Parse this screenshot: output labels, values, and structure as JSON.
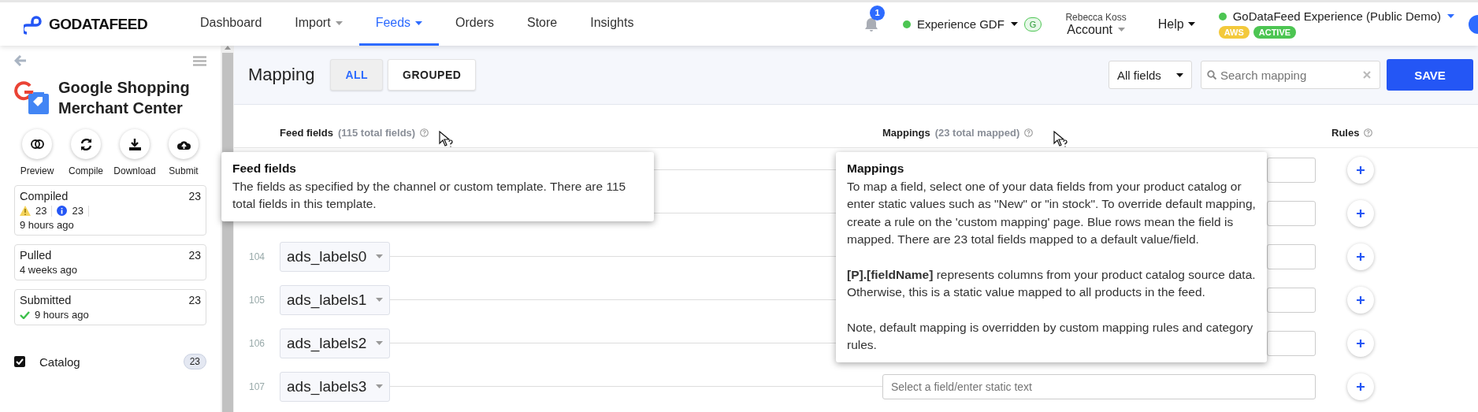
{
  "header": {
    "logo": "GODATAFEED",
    "nav": [
      {
        "label": "Dashboard",
        "selected": false,
        "dropdown": false
      },
      {
        "label": "Import",
        "selected": false,
        "dropdown": true
      },
      {
        "label": "Feeds",
        "selected": true,
        "dropdown": true
      },
      {
        "label": "Orders",
        "selected": false,
        "dropdown": false
      },
      {
        "label": "Store",
        "selected": false,
        "dropdown": false
      },
      {
        "label": "Insights",
        "selected": false,
        "dropdown": false
      }
    ],
    "notifications": "1",
    "store": {
      "name": "Experience GDF",
      "color": "#4cc552",
      "badge": "G"
    },
    "account": {
      "user": "Rebecca Koss",
      "label": "Account"
    },
    "help": "Help",
    "company": {
      "name": "GoDataFeed Experience (Public Demo)",
      "color": "#4cc552",
      "tags": [
        {
          "label": "AWS",
          "color": "#f3c93b"
        },
        {
          "label": "ACTIVE",
          "color": "#4cc552"
        }
      ]
    }
  },
  "sidebar": {
    "title": "Google Shopping Merchant Center",
    "actions": [
      {
        "label": "Preview",
        "kind": "preview"
      },
      {
        "label": "Compile",
        "kind": "compile"
      },
      {
        "label": "Download",
        "kind": "download"
      },
      {
        "label": "Submit",
        "kind": "submit"
      }
    ],
    "cards": [
      {
        "title": "Compiled",
        "count": "23",
        "warnings": "23",
        "info": "23",
        "time": "9 hours ago",
        "kind": "compiled"
      },
      {
        "title": "Pulled",
        "count": "23",
        "time": "4 weeks ago",
        "kind": "plain"
      },
      {
        "title": "Submitted",
        "count": "23",
        "time": "9 hours ago",
        "kind": "success"
      }
    ],
    "sources": [
      {
        "label": "Catalog",
        "checked": true,
        "count": "23"
      }
    ]
  },
  "mapping": {
    "title": "Mapping",
    "views": [
      {
        "label": "ALL",
        "selected": true
      },
      {
        "label": "GROUPED",
        "selected": false
      }
    ],
    "filter": "All fields",
    "search": {
      "placeholder": "Search mapping"
    },
    "save": "SAVE",
    "columns": [
      {
        "label": "Feed fields",
        "note": "(115 total fields)",
        "help": true
      },
      {
        "label": "Mappings",
        "note": "(23 total mapped)",
        "help": true
      },
      {
        "label": "Rules",
        "help": true
      }
    ],
    "rows": [
      {},
      {},
      {
        "number": "104",
        "field": "ads_labels0"
      },
      {
        "number": "105",
        "field": "ads_labels1"
      },
      {
        "number": "106",
        "field": "ads_labels2"
      },
      {
        "number": "107",
        "field": "ads_labels3",
        "placeholder": "Select a field/enter static text"
      }
    ],
    "tooltips": [
      {
        "title": "Feed fields",
        "paragraphs": [
          "The fields as specified by the channel or custom template. There are 115 total fields in this template."
        ]
      },
      {
        "title": "Mappings",
        "paragraphs": [
          "To map a field, select one of your data fields from your product catalog or enter static values such as \"New\" or \"in stock\". To override default mapping, create a rule on the 'custom mapping' page. Blue rows mean the field is mapped. There are 23 total fields mapped to a default value/field.",
          "**[P].[fieldName]** represents columns from your product catalog source data. Otherwise, this is a static value mapped to all products in the feed.",
          "Note, default mapping is overridden by custom mapping rules and category rules."
        ]
      }
    ]
  }
}
